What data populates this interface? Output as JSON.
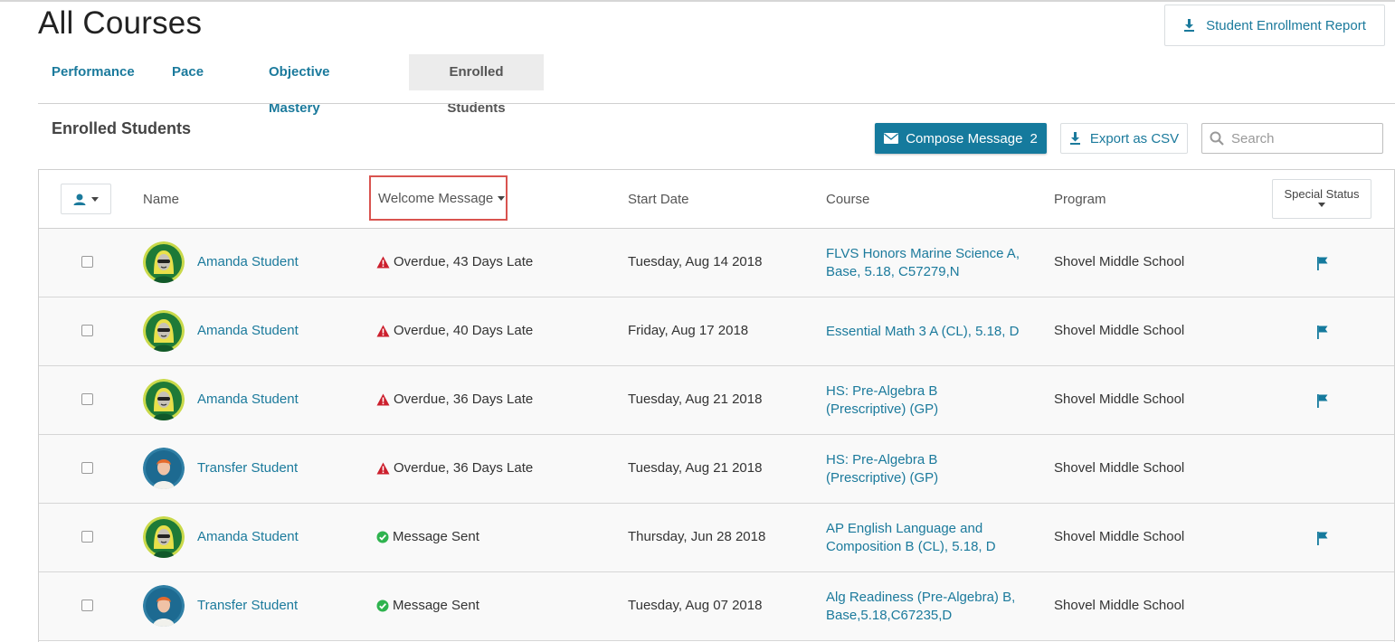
{
  "page": {
    "title": "All Courses"
  },
  "header": {
    "report_button": "Student Enrollment Report"
  },
  "tabs": [
    {
      "label": "Performance"
    },
    {
      "label": "Pace"
    },
    {
      "label": "Objective Mastery"
    },
    {
      "label": "Enrolled Students",
      "active": true
    }
  ],
  "section": {
    "title": "Enrolled Students"
  },
  "toolbar": {
    "compose_label": "Compose Message",
    "compose_count": "2",
    "export_label": "Export as CSV",
    "search_placeholder": "Search"
  },
  "table": {
    "headers": {
      "name": "Name",
      "welcome_message": "Welcome Message",
      "start_date": "Start Date",
      "course": "Course",
      "program": "Program",
      "special_status": "Special Status"
    },
    "rows": [
      {
        "name": "Amanda Student",
        "avatar": "amanda",
        "status": "Overdue, 43 Days Late",
        "status_type": "overdue",
        "start_date": "Tuesday, Aug 14 2018",
        "course": "FLVS Honors Marine Science A, Base, 5.18, C57279,N",
        "program": "Shovel Middle School",
        "flagged": true
      },
      {
        "name": "Amanda Student",
        "avatar": "amanda",
        "status": "Overdue, 40 Days Late",
        "status_type": "overdue",
        "start_date": "Friday, Aug 17 2018",
        "course": "Essential Math 3 A (CL), 5.18, D",
        "program": "Shovel Middle School",
        "flagged": true
      },
      {
        "name": "Amanda Student",
        "avatar": "amanda",
        "status": "Overdue, 36 Days Late",
        "status_type": "overdue",
        "start_date": "Tuesday, Aug 21 2018",
        "course": "HS: Pre-Algebra B (Prescriptive) (GP)",
        "program": "Shovel Middle School",
        "flagged": true
      },
      {
        "name": "Transfer Student",
        "avatar": "transfer",
        "status": "Overdue, 36 Days Late",
        "status_type": "overdue",
        "start_date": "Tuesday, Aug 21 2018",
        "course": "HS: Pre-Algebra B (Prescriptive) (GP)",
        "program": "Shovel Middle School",
        "flagged": false
      },
      {
        "name": "Amanda Student",
        "avatar": "amanda",
        "status": "Message Sent",
        "status_type": "sent",
        "start_date": "Thursday, Jun 28 2018",
        "course": "AP English Language and Composition B (CL), 5.18, D",
        "program": "Shovel Middle School",
        "flagged": true
      },
      {
        "name": "Transfer Student",
        "avatar": "transfer",
        "status": "Message Sent",
        "status_type": "sent",
        "start_date": "Tuesday, Aug 07 2018",
        "course": "Alg Readiness (Pre-Algebra) B, Base,5.18,C67235,D",
        "program": "Shovel Middle School",
        "flagged": false
      }
    ]
  },
  "colors": {
    "accent": "#157a9d",
    "link": "#1b7a9c",
    "overdue": "#cc1f2d",
    "sent": "#2eb34e",
    "highlight": "#d9534f"
  },
  "icons": {
    "download": "download-icon",
    "envelope": "envelope-icon",
    "search": "search-icon",
    "user": "user-icon",
    "warning": "warning-icon",
    "check": "check-circle-icon",
    "flag": "flag-icon"
  }
}
